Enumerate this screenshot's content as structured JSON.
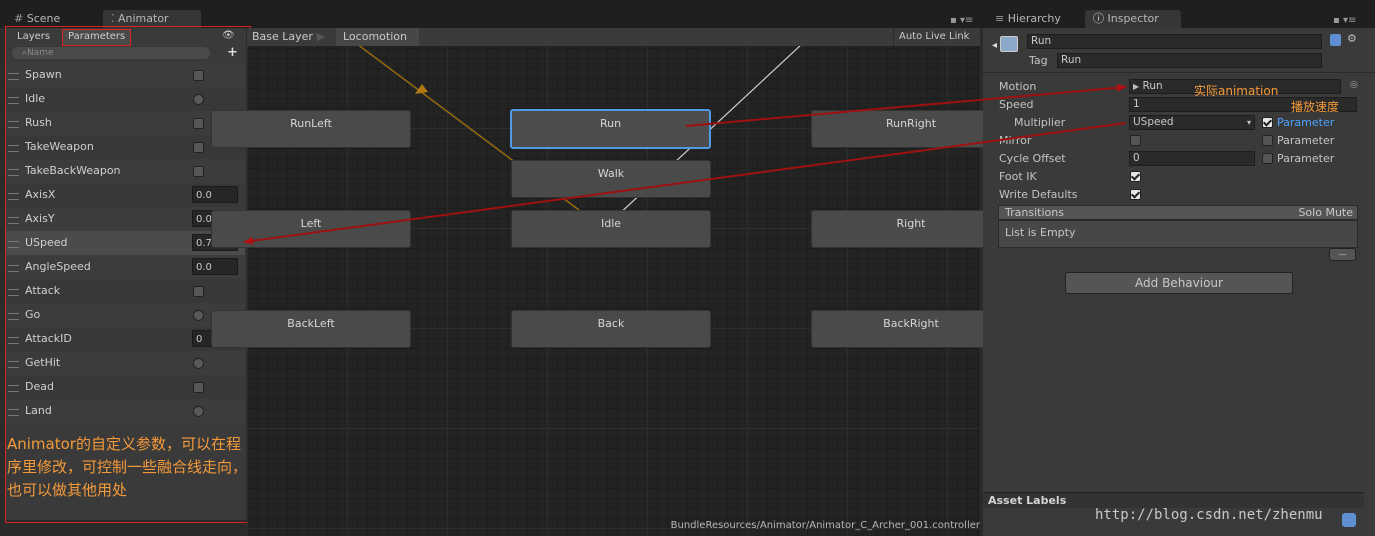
{
  "tabs": {
    "scene": "Scene",
    "animator": "Animator",
    "hierarchy": "Hierarchy",
    "inspector": "Inspector"
  },
  "window_ctrl": "▪ ▾≡",
  "params_panel": {
    "layers_tab": "Layers",
    "parameters_tab": "Parameters",
    "search_placeholder": "Name",
    "add": "+",
    "eye": "👁",
    "params": [
      {
        "name": "Spawn",
        "kind": "bool"
      },
      {
        "name": "Idle",
        "kind": "trigger"
      },
      {
        "name": "Rush",
        "kind": "bool"
      },
      {
        "name": "TakeWeapon",
        "kind": "bool"
      },
      {
        "name": "TakeBackWeapon",
        "kind": "bool"
      },
      {
        "name": "AxisX",
        "kind": "float",
        "value": "0.0"
      },
      {
        "name": "AxisY",
        "kind": "float",
        "value": "0.0"
      },
      {
        "name": "USpeed",
        "kind": "float",
        "value": "0.7"
      },
      {
        "name": "AngleSpeed",
        "kind": "float",
        "value": "0.0"
      },
      {
        "name": "Attack",
        "kind": "bool"
      },
      {
        "name": "Go",
        "kind": "trigger"
      },
      {
        "name": "AttackID",
        "kind": "int",
        "value": "0"
      },
      {
        "name": "GetHit",
        "kind": "trigger"
      },
      {
        "name": "Dead",
        "kind": "bool"
      },
      {
        "name": "Land",
        "kind": "trigger"
      }
    ],
    "note": "Animator的自定义参数，可以在程序里修改，可控制一些融合线走向，也可以做其他用处"
  },
  "graph": {
    "breadcrumbs": [
      "Base Layer",
      "Locomotion"
    ],
    "auto_live_link": "Auto Live Link",
    "nodes": {
      "runleft": "RunLeft",
      "run": "Run",
      "runright": "RunRight",
      "walk": "Walk",
      "left": "Left",
      "idle": "Idle",
      "right": "Right",
      "backleft": "BackLeft",
      "back": "Back",
      "backright": "BackRight"
    },
    "path": "BundleResources/Animator/Animator_C_Archer_001.controller"
  },
  "inspector": {
    "name": "Run",
    "tag_label": "Tag",
    "tag_value": "Run",
    "motion_label": "Motion",
    "motion_value": "Run",
    "motion_note": "实际animation",
    "speed_label": "Speed",
    "speed_value": "1",
    "speed_note": "播放速度",
    "multiplier_label": "Multiplier",
    "multiplier_value": "USpeed",
    "parameter_text": "Parameter",
    "mirror_label": "Mirror",
    "cycle_label": "Cycle Offset",
    "cycle_value": "0",
    "footik_label": "Foot IK",
    "writedef_label": "Write Defaults",
    "transitions_label": "Transitions",
    "solo_mute": "Solo Mute",
    "list_empty": "List is Empty",
    "minus": "—",
    "add_behaviour": "Add Behaviour",
    "asset_labels": "Asset Labels",
    "watermark": "http://blog.csdn.net/zhenmu"
  },
  "colors": {
    "annotation_red": "#d22222",
    "annotation_orange": "#f59a3a",
    "link_blue": "#4aa3ff",
    "select_blue": "#4f9ae3"
  }
}
